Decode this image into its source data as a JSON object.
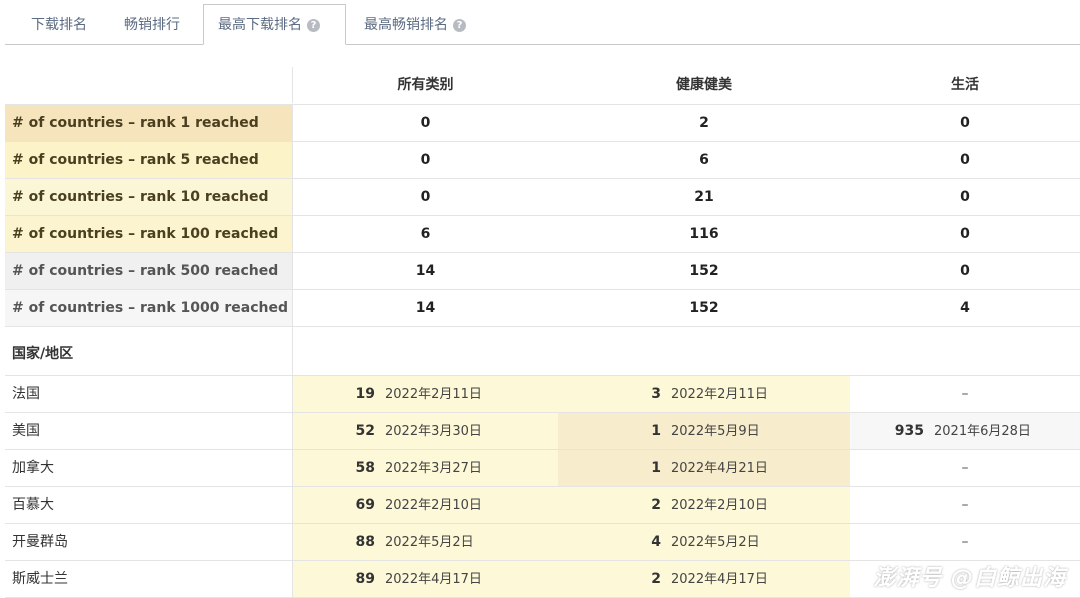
{
  "tabs": [
    {
      "label": "下载排名",
      "active": false,
      "help": false
    },
    {
      "label": "畅销排行",
      "active": false,
      "help": false
    },
    {
      "label": "最高下载排名",
      "active": true,
      "help": true
    },
    {
      "label": "最高畅销排名",
      "active": false,
      "help": true
    }
  ],
  "help_glyph": "?",
  "columns": [
    "所有类别",
    "健康健美",
    "生活"
  ],
  "rank_rows": [
    {
      "label": "# of countries – rank 1 reached",
      "values": [
        "0",
        "2",
        "0"
      ]
    },
    {
      "label": "# of countries – rank 5 reached",
      "values": [
        "0",
        "6",
        "0"
      ]
    },
    {
      "label": "# of countries – rank 10 reached",
      "values": [
        "0",
        "21",
        "0"
      ]
    },
    {
      "label": "# of countries – rank 100 reached",
      "values": [
        "6",
        "116",
        "0"
      ]
    },
    {
      "label": "# of countries – rank 500 reached",
      "values": [
        "14",
        "152",
        "0"
      ]
    },
    {
      "label": "# of countries – rank 1000 reached",
      "values": [
        "14",
        "152",
        "4"
      ]
    }
  ],
  "section_label": "国家/地区",
  "countries": [
    {
      "name": "法国",
      "cells": [
        {
          "rank": "19",
          "date": "2022年2月11日"
        },
        {
          "rank": "3",
          "date": "2022年2月11日"
        },
        {
          "dash": "–"
        }
      ]
    },
    {
      "name": "美国",
      "cells": [
        {
          "rank": "52",
          "date": "2022年3月30日"
        },
        {
          "rank": "1",
          "date": "2022年5月9日"
        },
        {
          "rank": "935",
          "date": "2021年6月28日"
        }
      ]
    },
    {
      "name": "加拿大",
      "cells": [
        {
          "rank": "58",
          "date": "2022年3月27日"
        },
        {
          "rank": "1",
          "date": "2022年4月21日"
        },
        {
          "dash": "–"
        }
      ]
    },
    {
      "name": "百慕大",
      "cells": [
        {
          "rank": "69",
          "date": "2022年2月10日"
        },
        {
          "rank": "2",
          "date": "2022年2月10日"
        },
        {
          "dash": "–"
        }
      ]
    },
    {
      "name": "开曼群岛",
      "cells": [
        {
          "rank": "88",
          "date": "2022年5月2日"
        },
        {
          "rank": "4",
          "date": "2022年5月2日"
        },
        {
          "dash": "–"
        }
      ]
    },
    {
      "name": "斯威士兰",
      "cells": [
        {
          "rank": "89",
          "date": "2022年4月17日"
        },
        {
          "rank": "2",
          "date": "2022年4月17日"
        },
        {
          "dash": ""
        }
      ]
    }
  ],
  "watermark": "澎湃号 @白鲸出海",
  "colors": {
    "tab_text": "#5b6b82",
    "rank1_bg": "#f6e5bc",
    "top_bg": "#fdf3c9",
    "gray_bg": "#f0f0f0",
    "rank_cell_bg": "#fdf8d8",
    "top_rank_bg": "#f7eccc"
  }
}
